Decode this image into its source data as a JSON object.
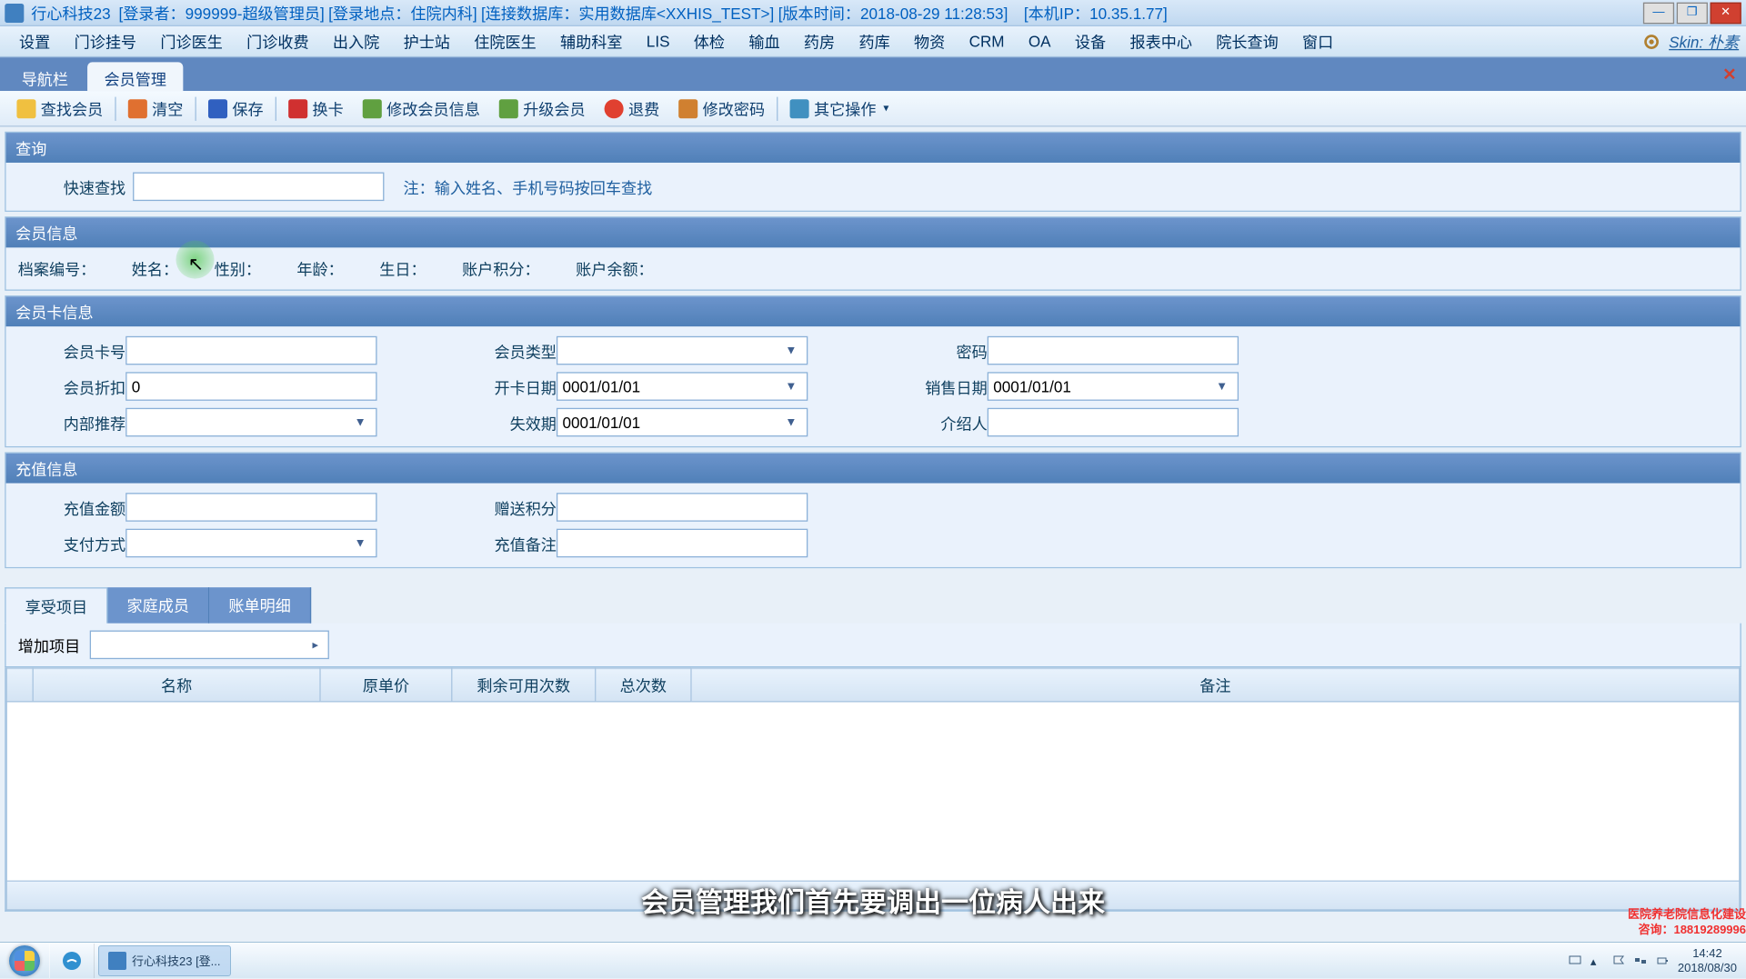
{
  "title": {
    "app": "行心科技23",
    "loginUser": "[登录者：999999-超级管理员]",
    "loginLoc": "[登录地点：住院内科]",
    "db": "[连接数据库：实用数据库<XXHIS_TEST>]",
    "verTime": "[版本时间：2018-08-29 11:28:53]",
    "ip": "[本机IP：10.35.1.77]"
  },
  "menubar": [
    "设置",
    "门诊挂号",
    "门诊医生",
    "门诊收费",
    "出入院",
    "护士站",
    "住院医生",
    "辅助科室",
    "LIS",
    "体检",
    "输血",
    "药房",
    "药库",
    "物资",
    "CRM",
    "OA",
    "设备",
    "报表中心",
    "院长查询",
    "窗口"
  ],
  "skinLabel": "Skin: 朴素",
  "tabs": {
    "nav": "导航栏",
    "member": "会员管理"
  },
  "toolbar": {
    "find": "查找会员",
    "clear": "清空",
    "save": "保存",
    "swap": "换卡",
    "edit": "修改会员信息",
    "upgrade": "升级会员",
    "refund": "退费",
    "pwd": "修改密码",
    "other": "其它操作"
  },
  "search": {
    "head": "查询",
    "label": "快速查找",
    "hint": "注：输入姓名、手机号码按回车查找",
    "value": ""
  },
  "memberInfo": {
    "head": "会员信息",
    "fields": {
      "fileNo": "档案编号：",
      "name": "姓名：",
      "sex": "性别：",
      "age": "年龄：",
      "birth": "生日：",
      "points": "账户积分：",
      "balance": "账户余额："
    }
  },
  "cardInfo": {
    "head": "会员卡信息",
    "labels": {
      "cardNo": "会员卡号",
      "type": "会员类型",
      "pwd": "密码",
      "discount": "会员折扣",
      "openDate": "开卡日期",
      "saleDate": "销售日期",
      "internal": "内部推荐",
      "expire": "失效期",
      "referrer": "介绍人"
    },
    "values": {
      "cardNo": "",
      "type": "",
      "pwd": "",
      "discount": "0",
      "openDate": "0001/01/01",
      "saleDate": "0001/01/01",
      "internal": "",
      "expire": "0001/01/01",
      "referrer": ""
    }
  },
  "recharge": {
    "head": "充值信息",
    "labels": {
      "amount": "充值金额",
      "bonus": "赠送积分",
      "payType": "支付方式",
      "remark": "充值备注"
    },
    "values": {
      "amount": "",
      "bonus": "",
      "payType": "",
      "remark": ""
    }
  },
  "innerTabs": {
    "items": "享受项目",
    "family": "家庭成员",
    "bill": "账单明细"
  },
  "addItemLabel": "增加项目",
  "gridCols": [
    "",
    "名称",
    "原单价",
    "剩余可用次数",
    "总次数",
    "备注"
  ],
  "subtitle": "会员管理我们首先要调出一位病人出来",
  "ad": {
    "l1": "医院养老院信息化建设",
    "l2": "咨询：18819289996"
  },
  "taskbar": {
    "app": "行心科技23   [登...",
    "time": "14:42",
    "date": "2018/08/30"
  }
}
